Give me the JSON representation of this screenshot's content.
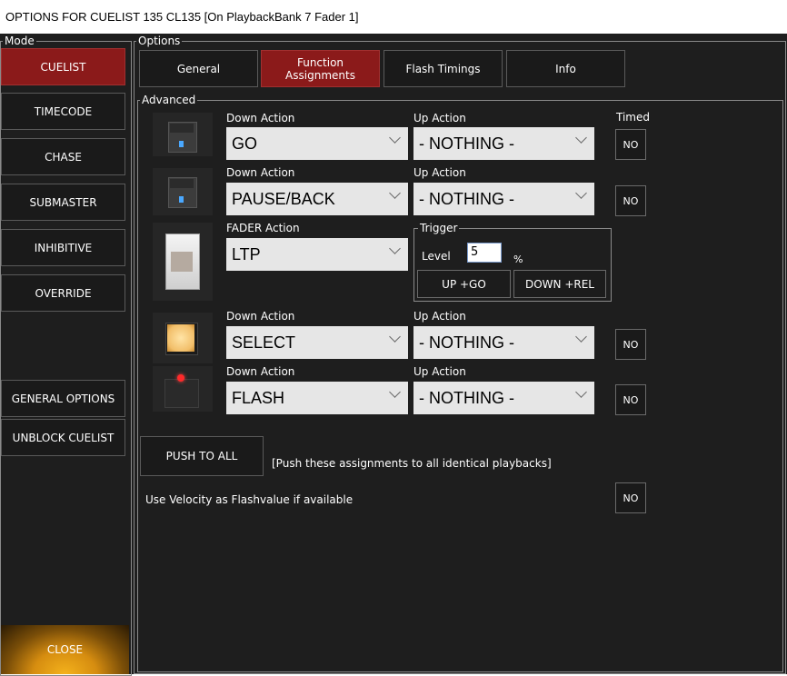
{
  "window": {
    "title": "OPTIONS FOR CUELIST 135 CL135  [On PlaybackBank 7 Fader 1]"
  },
  "mode": {
    "legend": "Mode",
    "items": [
      {
        "label": "CUELIST",
        "active": true
      },
      {
        "label": "TIMECODE"
      },
      {
        "label": "CHASE"
      },
      {
        "label": "SUBMASTER"
      },
      {
        "label": "INHIBITIVE"
      },
      {
        "label": "OVERRIDE"
      }
    ],
    "general_options": "GENERAL OPTIONS",
    "unblock_cuelist": "UNBLOCK CUELIST",
    "close": "CLOSE"
  },
  "options": {
    "legend": "Options",
    "tabs": [
      {
        "label": "General"
      },
      {
        "label": "Function Assignments",
        "active": true
      },
      {
        "label": "Flash Timings"
      },
      {
        "label": "Info"
      }
    ]
  },
  "advanced": {
    "legend": "Advanced",
    "timed_header": "Timed",
    "rows": [
      {
        "down_label": "Down Action",
        "down_value": "GO",
        "up_label": "Up Action",
        "up_value": "- NOTHING -",
        "timed": "NO"
      },
      {
        "down_label": "Down Action",
        "down_value": "PAUSE/BACK",
        "up_label": "Up Action",
        "up_value": "- NOTHING -",
        "timed": "NO"
      },
      {
        "down_label": "Down Action",
        "down_value": "SELECT",
        "up_label": "Up Action",
        "up_value": "- NOTHING -",
        "timed": "NO"
      },
      {
        "down_label": "Down Action",
        "down_value": "FLASH",
        "up_label": "Up Action",
        "up_value": "- NOTHING -",
        "timed": "NO"
      }
    ],
    "fader": {
      "label": "FADER Action",
      "value": "LTP",
      "trigger_legend": "Trigger",
      "level_label": "Level",
      "level_value": "5",
      "percent": "%",
      "up_go": "UP +GO",
      "down_rel": "DOWN +REL"
    },
    "push_to_all": "PUSH TO ALL",
    "push_note": "[Push these assignments to all identical playbacks]",
    "velocity_label": "Use Velocity as Flashvalue if available",
    "velocity_value": "NO"
  },
  "colors": {
    "active_red": "#8b1a1a",
    "background": "#1e1e1e",
    "close_orange": "#e8a316"
  },
  "icons": [
    "playback-button-blue-led-icon",
    "playback-button-blue-led-icon",
    "fader-icon",
    "select-button-lit-icon",
    "flash-button-red-led-icon",
    "chevron-down-icon"
  ]
}
